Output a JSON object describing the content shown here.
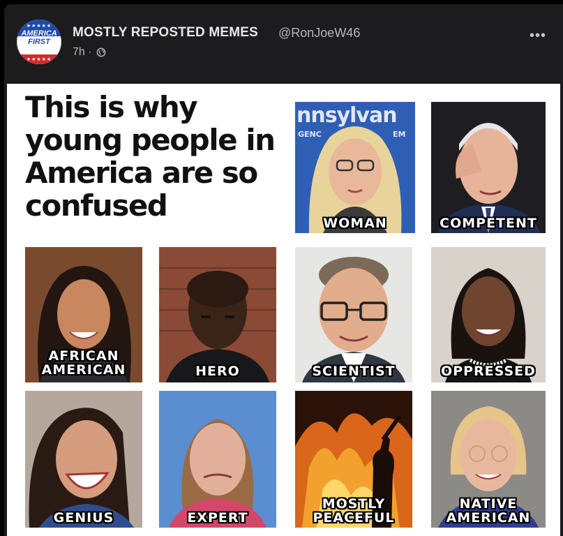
{
  "post": {
    "author": "MOSTLY REPOSTED MEMES",
    "handle": "@RonJoeW46",
    "time": "7h ·",
    "more_icon": "more-dots-icon",
    "privacy_icon": "globe-icon"
  },
  "avatar": {
    "line1": "AMERICA",
    "line2": "FIRST",
    "stars": "★★★★★"
  },
  "meme": {
    "headline": "This is why young people in America are so confused",
    "sign_text": "nnsylvan",
    "sign_small_left": "GENC",
    "sign_small_right": "EM",
    "tiles": [
      {
        "label": "WOMAN"
      },
      {
        "label": "COMPETENT"
      },
      {
        "label": "AFRICAN\nAMERICAN"
      },
      {
        "label": "HERO"
      },
      {
        "label": "SCIENTIST"
      },
      {
        "label": "OPPRESSED"
      },
      {
        "label": "GENIUS"
      },
      {
        "label": "EXPERT"
      },
      {
        "label": "MOSTLY\nPEACEFUL"
      },
      {
        "label": "NATIVE\nAMERICAN"
      }
    ]
  },
  "colors": {
    "card_bg": "#1c1c1e",
    "author_text": "#e8e8e8",
    "secondary_text": "#b7b7bb",
    "avatar_blue": "#1f4aa8",
    "avatar_red": "#d42a2a"
  }
}
